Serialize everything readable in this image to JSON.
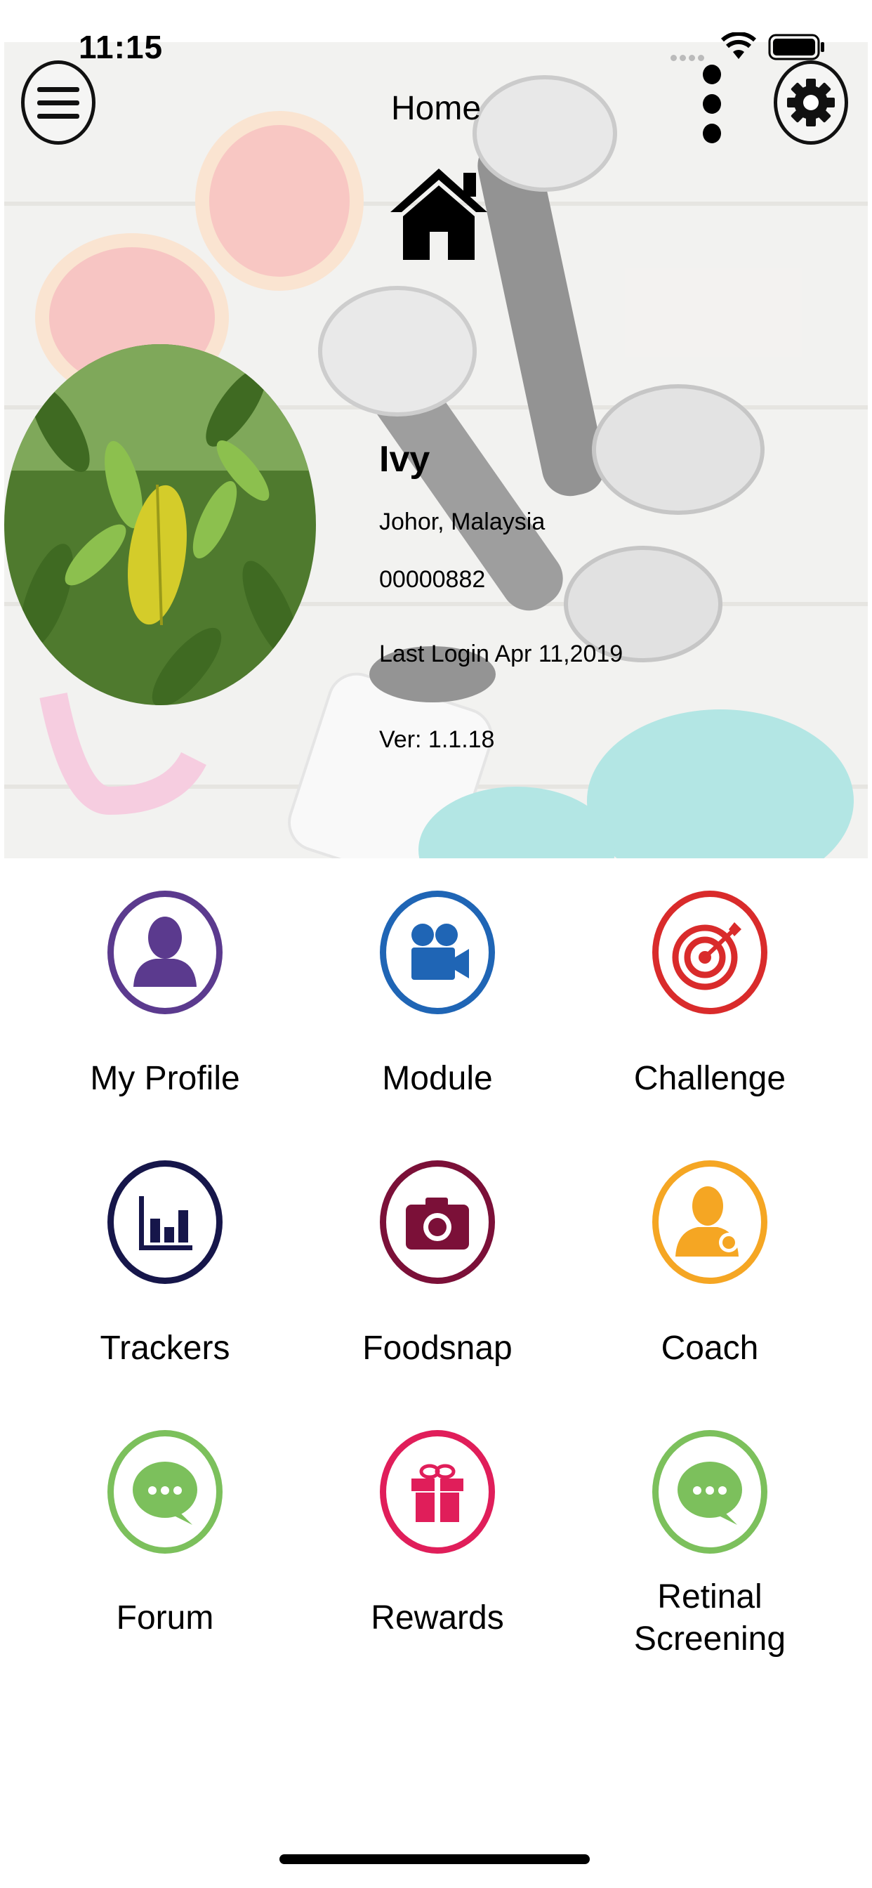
{
  "status_bar": {
    "time": "11:15",
    "icons": [
      "signal-dots-icon",
      "wifi-icon",
      "battery-icon"
    ]
  },
  "header": {
    "title": "Home",
    "icons": [
      "menu-icon",
      "more-vertical-icon",
      "gear-icon",
      "home-icon"
    ]
  },
  "profile": {
    "name": "Ivy",
    "location": "Johor, Malaysia",
    "member_id": "00000882",
    "last_login": "Last Login Apr 11,2019",
    "version": "Ver: 1.1.18"
  },
  "tiles": [
    {
      "label": "My Profile",
      "icon": "user-icon",
      "color": "#5b3a8e"
    },
    {
      "label": "Module",
      "icon": "video-camera-icon",
      "color": "#1f65b5"
    },
    {
      "label": "Challenge",
      "icon": "target-icon",
      "color": "#d92b2b"
    },
    {
      "label": "Trackers",
      "icon": "bar-chart-icon",
      "color": "#16164a"
    },
    {
      "label": "Foodsnap",
      "icon": "camera-icon",
      "color": "#7b1038"
    },
    {
      "label": "Coach",
      "icon": "coach-icon",
      "color": "#f5a623"
    },
    {
      "label": "Forum",
      "icon": "chat-bubble-icon",
      "color": "#7cc05c"
    },
    {
      "label": "Rewards",
      "icon": "gift-icon",
      "color": "#e01e5a"
    },
    {
      "label": "Retinal Screening",
      "icon": "chat-bubble-icon",
      "color": "#7cc05c"
    }
  ]
}
